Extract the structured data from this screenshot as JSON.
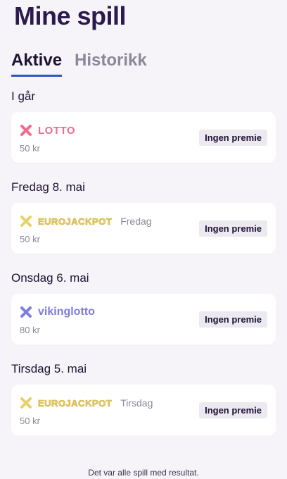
{
  "page": {
    "title": "Mine spill"
  },
  "tabs": [
    {
      "label": "Aktive",
      "active": true
    },
    {
      "label": "Historikk",
      "active": false
    }
  ],
  "sections": [
    {
      "date": "I går",
      "game": {
        "logo_text": "LOTTO",
        "icon": "x-cross-icon",
        "brand_color": "#f06b8d",
        "subtitle": ""
      },
      "price": "50 kr",
      "status": "Ingen premie"
    },
    {
      "date": "Fredag 8. mai",
      "game": {
        "logo_text": "EUROJACKPOT",
        "icon": "x-cross-icon",
        "brand_color": "#e9d067",
        "subtitle": "Fredag"
      },
      "price": "50 kr",
      "status": "Ingen premie"
    },
    {
      "date": "Onsdag 6. mai",
      "game": {
        "logo_text": "vikinglotto",
        "icon": "x-cross-icon",
        "brand_color": "#7d7ce0",
        "subtitle": ""
      },
      "price": "80 kr",
      "status": "Ingen premie"
    },
    {
      "date": "Tirsdag 5. mai",
      "game": {
        "logo_text": "EUROJACKPOT",
        "icon": "x-cross-icon",
        "brand_color": "#e9d067",
        "subtitle": "Tirsdag"
      },
      "price": "50 kr",
      "status": "Ingen premie"
    }
  ],
  "footer": {
    "text": "Det var alle spill med resultat."
  }
}
